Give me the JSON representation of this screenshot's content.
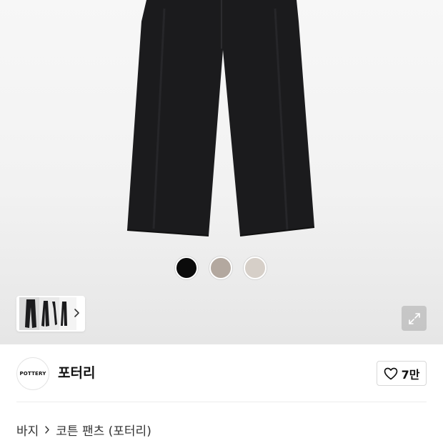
{
  "product_gallery": {
    "color_options": [
      {
        "name": "black",
        "color": "#0b0b0b"
      },
      {
        "name": "taupe",
        "color": "#b3a89f"
      },
      {
        "name": "beige",
        "color": "#d6cfc8"
      }
    ],
    "pants_color": "#1a1a1c",
    "thumbnail_next_icon": "chevron-right-icon",
    "zoom_icon": "expand-icon"
  },
  "brand": {
    "logo_text": "POTTERY",
    "name": "포터리",
    "like_icon": "heart-outline-icon",
    "like_count": "7만"
  },
  "breadcrumb": {
    "category": "바지",
    "separator_icon": "chevron-right-icon",
    "current": "코튼 팬츠 (포터리)"
  }
}
